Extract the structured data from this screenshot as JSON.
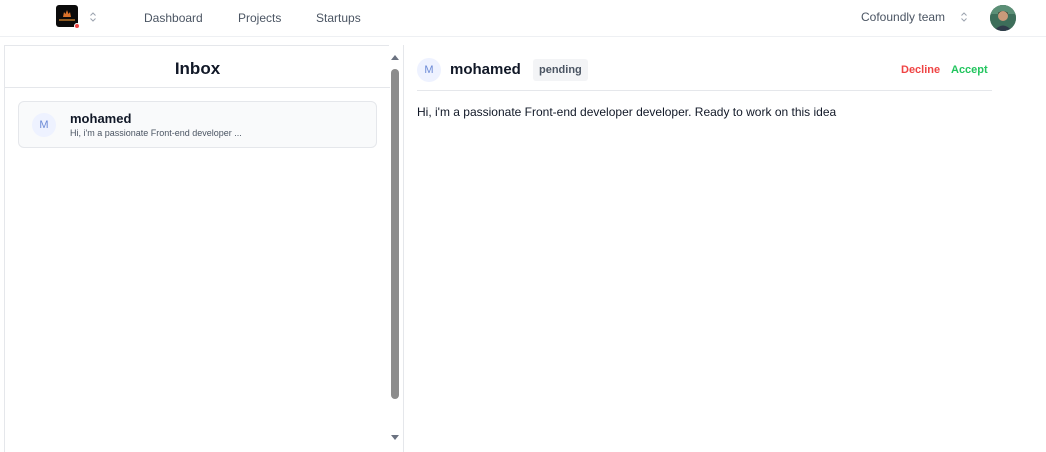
{
  "nav": {
    "logo_icon": "app-logo",
    "items": [
      {
        "label": "Dashboard"
      },
      {
        "label": "Projects"
      },
      {
        "label": "Startups"
      }
    ],
    "team_label": "Cofoundly team",
    "user_avatar_icon": "user-avatar"
  },
  "inbox": {
    "title": "Inbox",
    "messages": [
      {
        "initial": "M",
        "name": "mohamed",
        "preview": "Hi, i'm a passionate Front-end developer ..."
      }
    ]
  },
  "conversation": {
    "initial": "M",
    "name": "mohamed",
    "status": "pending",
    "decline_label": "Decline",
    "accept_label": "Accept",
    "body": "Hi, i'm a passionate Front-end developer developer. Ready to work on this idea"
  },
  "colors": {
    "decline": "#ef4444",
    "accept": "#22c55e",
    "avatar_bg": "#eef2ff",
    "avatar_text": "#6b8ad6"
  }
}
